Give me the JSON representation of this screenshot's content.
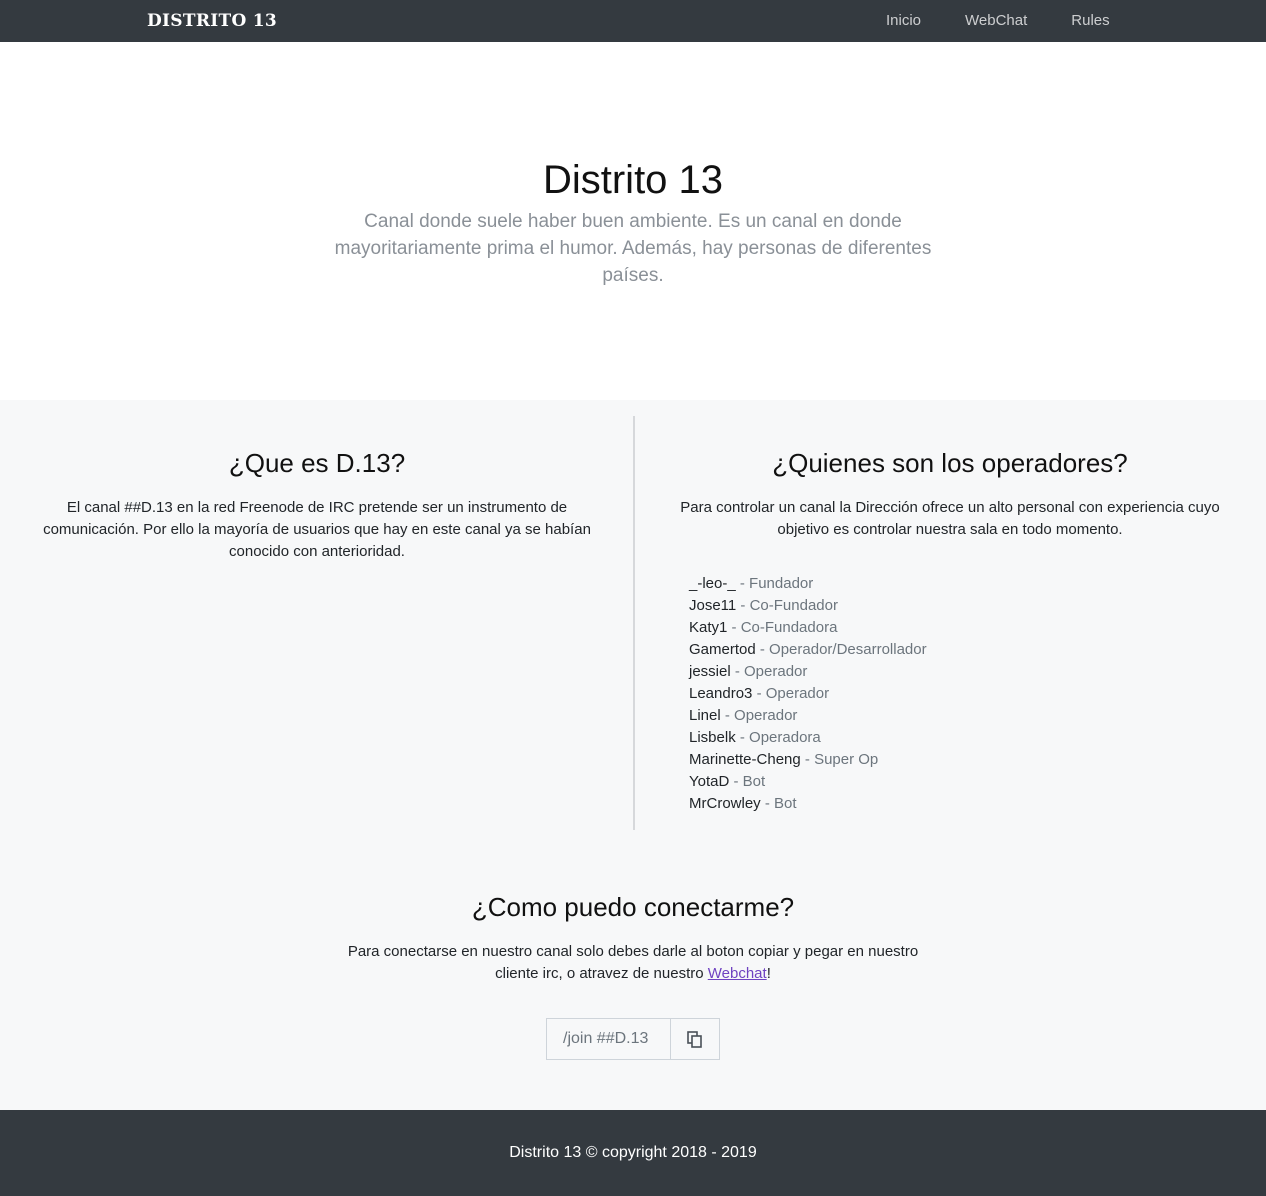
{
  "nav": {
    "brand": "DISTRITO 13",
    "links": [
      "Inicio",
      "WebChat",
      "Rules"
    ]
  },
  "hero": {
    "title": "Distrito 13",
    "lead": "Canal donde suele haber buen ambiente. Es un canal en donde mayoritariamente prima el humor. Además, hay personas de diferentes países."
  },
  "about": {
    "title": "¿Que es D.13?",
    "text": "El canal ##D.13 en la red Freenode de IRC pretende ser un instrumento de comunicación. Por ello la mayoría de usuarios que hay en este canal ya se habían conocido con anterioridad."
  },
  "operators": {
    "title": "¿Quienes son los operadores?",
    "text": "Para controlar un canal la Dirección ofrece un alto personal con experiencia cuyo objetivo es controlar nuestra sala en todo momento.",
    "list": [
      {
        "nick": "_-leo-_",
        "role": " - Fundador"
      },
      {
        "nick": "Jose11",
        "role": " - Co-Fundador"
      },
      {
        "nick": "Katy1",
        "role": " - Co-Fundadora"
      },
      {
        "nick": "Gamertod",
        "role": " - Operador/Desarrollador"
      },
      {
        "nick": "jessiel",
        "role": " - Operador"
      },
      {
        "nick": "Leandro3",
        "role": " - Operador"
      },
      {
        "nick": "Linel",
        "role": " - Operador"
      },
      {
        "nick": "Lisbelk",
        "role": " - Operadora"
      },
      {
        "nick": "Marinette-Cheng",
        "role": " - Super Op"
      },
      {
        "nick": "YotaD",
        "role": " - Bot"
      },
      {
        "nick": "MrCrowley",
        "role": " - Bot"
      }
    ]
  },
  "connect": {
    "title": "¿Como puedo conectarme?",
    "text_before": "Para conectarse en nuestro canal solo debes darle al boton copiar y pegar en nuestro cliente irc, o atravez de nuestro ",
    "link": "Webchat",
    "text_after": "!",
    "join_value": "/join ##D.13",
    "copy_icon": "copy-icon"
  },
  "footer": {
    "text": "Distrito 13 © copyright 2018 - 2019"
  }
}
